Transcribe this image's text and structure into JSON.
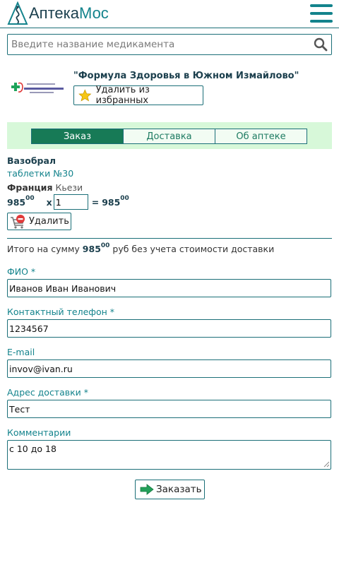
{
  "header": {
    "logo_part1": "Аптека",
    "logo_part2": "Мос",
    "menu_icon": "hamburger-menu-icon",
    "logo_icon": "pharmacy-logo-icon"
  },
  "search": {
    "placeholder": "Введите название медикамента",
    "icon": "search-icon"
  },
  "pharmacy": {
    "name": "\"Формула Здоровья в Южном Измайлово\"",
    "favorite_label": "Удалить из избранных",
    "favorite_icon": "star-icon"
  },
  "tabs": [
    {
      "label": "Заказ",
      "active": true
    },
    {
      "label": "Доставка",
      "active": false
    },
    {
      "label": "Об аптеке",
      "active": false
    }
  ],
  "product": {
    "name": "Вазобрал",
    "form": "таблетки №30",
    "country": "Франция",
    "manufacturer": "Кьези",
    "price_main": "985",
    "price_cents": "00",
    "times": "x",
    "quantity": "1",
    "equals": "=",
    "sum_main": "985",
    "sum_cents": "00",
    "delete_label": "Удалить",
    "delete_icon": "cart-remove-icon"
  },
  "total": {
    "prefix": "Итого на сумму",
    "amount_main": "985",
    "amount_cents": "00",
    "suffix": "руб без учета стоимости доставки"
  },
  "form": {
    "fio_label": "ФИО *",
    "fio_value": "Иванов Иван Иванович",
    "phone_label": "Контактный телефон *",
    "phone_value": "1234567",
    "email_label": "E-mail",
    "email_value": "invov@ivan.ru",
    "address_label": "Адрес доставки *",
    "address_value": "Тест",
    "comment_label": "Комментарии",
    "comment_value": "с 10 до 18",
    "submit_label": "Заказать",
    "submit_icon": "arrow-right-icon"
  },
  "colors": {
    "primary": "#13838c",
    "border": "#1b6f78",
    "dark_text": "#1b3f4d",
    "tab_active": "#177a56",
    "tab_bar": "#d7f8d9",
    "star": "#f6c614",
    "remove": "#e03a3a",
    "arrow": "#23a05a"
  }
}
